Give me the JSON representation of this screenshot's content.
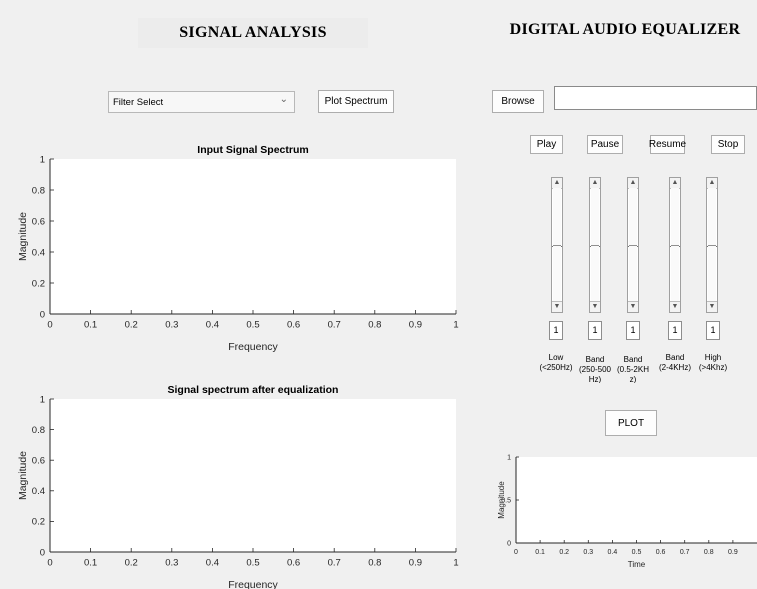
{
  "signal_analysis": {
    "title": "SIGNAL ANALYSIS",
    "filter_select": {
      "value": "Filter Select"
    },
    "plot_spectrum_label": "Plot Spectrum"
  },
  "equalizer": {
    "title": "DIGITAL AUDIO EQUALIZER",
    "browse_label": "Browse",
    "file_path": "",
    "controls": {
      "play": "Play",
      "pause": "Pause",
      "resume": "Resume",
      "stop": "Stop"
    },
    "bands": [
      {
        "value": "1",
        "label_line1": "Low",
        "label_line2": "(<250Hz)",
        "label_line3": ""
      },
      {
        "value": "1",
        "label_line1": "Band",
        "label_line2": "(250-500",
        "label_line3": "Hz)"
      },
      {
        "value": "1",
        "label_line1": "Band",
        "label_line2": "(0.5-2KH",
        "label_line3": "z)"
      },
      {
        "value": "1",
        "label_line1": "Band",
        "label_line2": "(2-4KHz)",
        "label_line3": ""
      },
      {
        "value": "1",
        "label_line1": "High",
        "label_line2": "(>4Khz)",
        "label_line3": ""
      }
    ],
    "plot_label": "PLOT"
  },
  "chart_data": [
    {
      "type": "line",
      "title": "Input Signal Spectrum",
      "xlabel": "Frequency",
      "ylabel": "Magnitude",
      "xlim": [
        0,
        1
      ],
      "ylim": [
        0,
        1
      ],
      "xticks": [
        "0",
        "0.1",
        "0.2",
        "0.3",
        "0.4",
        "0.5",
        "0.6",
        "0.7",
        "0.8",
        "0.9",
        "1"
      ],
      "yticks": [
        "0",
        "0.2",
        "0.4",
        "0.6",
        "0.8",
        "1"
      ],
      "series": [],
      "grid": false
    },
    {
      "type": "line",
      "title": "Signal spectrum after equalization",
      "xlabel": "Frequency",
      "ylabel": "Magnitude",
      "xlim": [
        0,
        1
      ],
      "ylim": [
        0,
        1
      ],
      "xticks": [
        "0",
        "0.1",
        "0.2",
        "0.3",
        "0.4",
        "0.5",
        "0.6",
        "0.7",
        "0.8",
        "0.9",
        "1"
      ],
      "yticks": [
        "0",
        "0.2",
        "0.4",
        "0.6",
        "0.8",
        "1"
      ],
      "series": [],
      "grid": false
    },
    {
      "type": "line",
      "title": "",
      "xlabel": "Time",
      "ylabel": "Magnitude",
      "xlim": [
        0,
        1
      ],
      "ylim": [
        0,
        1
      ],
      "xticks": [
        "0",
        "0.1",
        "0.2",
        "0.3",
        "0.4",
        "0.5",
        "0.6",
        "0.7",
        "0.8",
        "0.9"
      ],
      "yticks": [
        "0",
        "0.5",
        "1"
      ],
      "series": [],
      "grid": false
    }
  ]
}
